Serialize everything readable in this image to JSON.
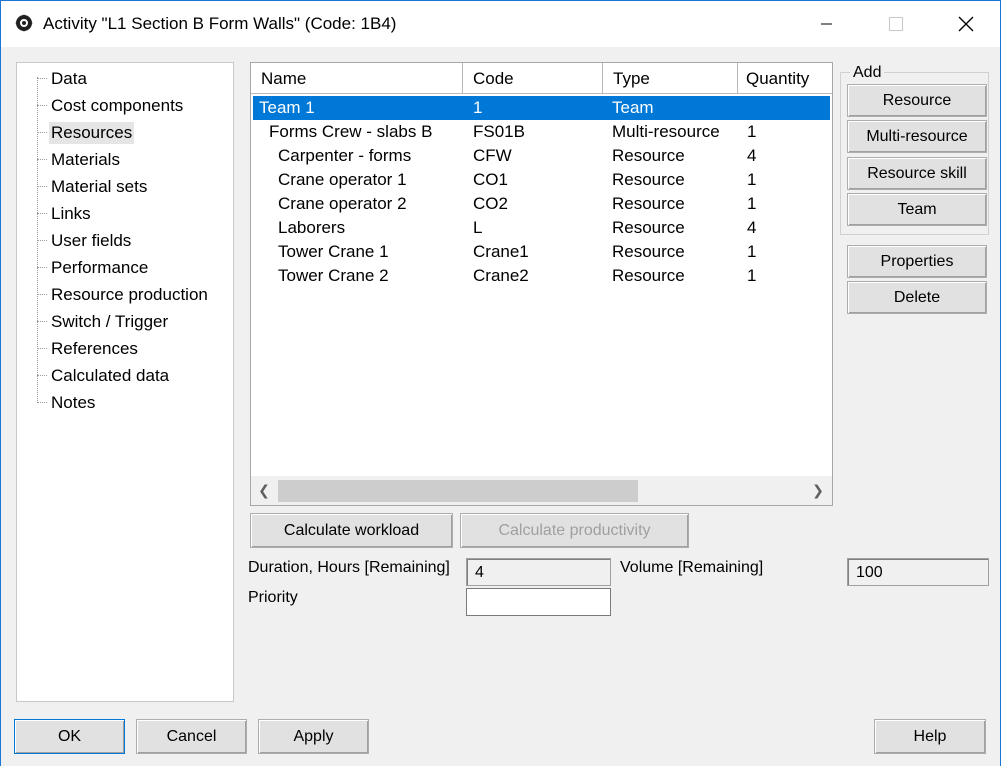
{
  "window": {
    "title": "Activity \"L1 Section B Form Walls\" (Code: 1B4)",
    "app_icon": "app-logo-icon",
    "controls": {
      "minimize": "minimize-icon",
      "maximize": "maximize-icon",
      "close": "close-icon"
    },
    "accent": "#1976d2"
  },
  "tree": {
    "items": [
      {
        "label": "Data"
      },
      {
        "label": "Cost components"
      },
      {
        "label": "Resources",
        "selected": true
      },
      {
        "label": "Materials"
      },
      {
        "label": "Material sets"
      },
      {
        "label": "Links"
      },
      {
        "label": "User fields"
      },
      {
        "label": "Performance"
      },
      {
        "label": "Resource production"
      },
      {
        "label": "Switch / Trigger"
      },
      {
        "label": "References"
      },
      {
        "label": "Calculated data"
      },
      {
        "label": "Notes"
      }
    ]
  },
  "grid": {
    "columns": [
      "Name",
      "Code",
      "Type",
      "Quantity"
    ],
    "rows": [
      {
        "name": "Team 1",
        "code": "1",
        "type": "Team",
        "qty": "",
        "level": 0,
        "selected": true
      },
      {
        "name": "Forms Crew - slabs B",
        "code": "FS01B",
        "type": "Multi-resource",
        "qty": "1",
        "level": 1
      },
      {
        "name": "Carpenter - forms",
        "code": "CFW",
        "type": "Resource",
        "qty": "4",
        "level": 2
      },
      {
        "name": "Crane operator 1",
        "code": "CO1",
        "type": "Resource",
        "qty": "1",
        "level": 2
      },
      {
        "name": "Crane operator 2",
        "code": "CO2",
        "type": "Resource",
        "qty": "1",
        "level": 2
      },
      {
        "name": "Laborers",
        "code": "L",
        "type": "Resource",
        "qty": "4",
        "level": 2
      },
      {
        "name": "Tower Crane 1",
        "code": "Crane1",
        "type": "Resource",
        "qty": "1",
        "level": 2
      },
      {
        "name": "Tower Crane 2",
        "code": "Crane2",
        "type": "Resource",
        "qty": "1",
        "level": 2
      }
    ],
    "selected_color": "#0078d7"
  },
  "add_group": {
    "label": "Add",
    "buttons": {
      "resource": "Resource",
      "multi_resource": "Multi-resource",
      "resource_skill": "Resource skill",
      "team": "Team"
    }
  },
  "side_buttons": {
    "properties": "Properties",
    "delete": "Delete"
  },
  "calc": {
    "workload": "Calculate workload",
    "productivity": "Calculate productivity"
  },
  "fields": {
    "duration_label": "Duration, Hours [Remaining]",
    "duration_value": "4",
    "volume_label": "Volume [Remaining]",
    "volume_value": "100",
    "priority_label": "Priority",
    "priority_value": ""
  },
  "footer": {
    "ok": "OK",
    "cancel": "Cancel",
    "apply": "Apply",
    "help": "Help"
  }
}
